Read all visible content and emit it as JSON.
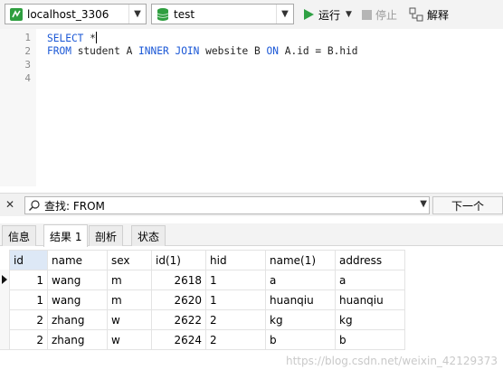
{
  "toolbar": {
    "connection": "localhost_3306",
    "database": "test",
    "run_label": "运行",
    "stop_label": "停止",
    "explain_label": "解释"
  },
  "editor": {
    "line_numbers": [
      "1",
      "2",
      "3",
      "4"
    ],
    "line1": {
      "kw": "SELECT",
      "rest": " *"
    },
    "line2": {
      "kw1": "FROM",
      "t1": " student A ",
      "kw2": "INNER JOIN",
      "t2": " website B ",
      "kw3": "ON",
      "t3": " A.id = B.hid"
    }
  },
  "findbar": {
    "value": "查找: FROM",
    "next_label": "下一个"
  },
  "tabs": [
    "信息",
    "结果 1",
    "剖析",
    "状态"
  ],
  "results": {
    "columns": [
      "id",
      "name",
      "sex",
      "id(1)",
      "hid",
      "name(1)",
      "address"
    ],
    "rows": [
      [
        "1",
        "wang",
        "m",
        "2618",
        "1",
        "a",
        "a"
      ],
      [
        "1",
        "wang",
        "m",
        "2620",
        "1",
        "huanqiu",
        "huanqiu"
      ],
      [
        "2",
        "zhang",
        "w",
        "2622",
        "2",
        "kg",
        "kg"
      ],
      [
        "2",
        "zhang",
        "w",
        "2624",
        "2",
        "b",
        "b"
      ]
    ]
  },
  "watermark": "https://blog.csdn.net/weixin_42129373"
}
